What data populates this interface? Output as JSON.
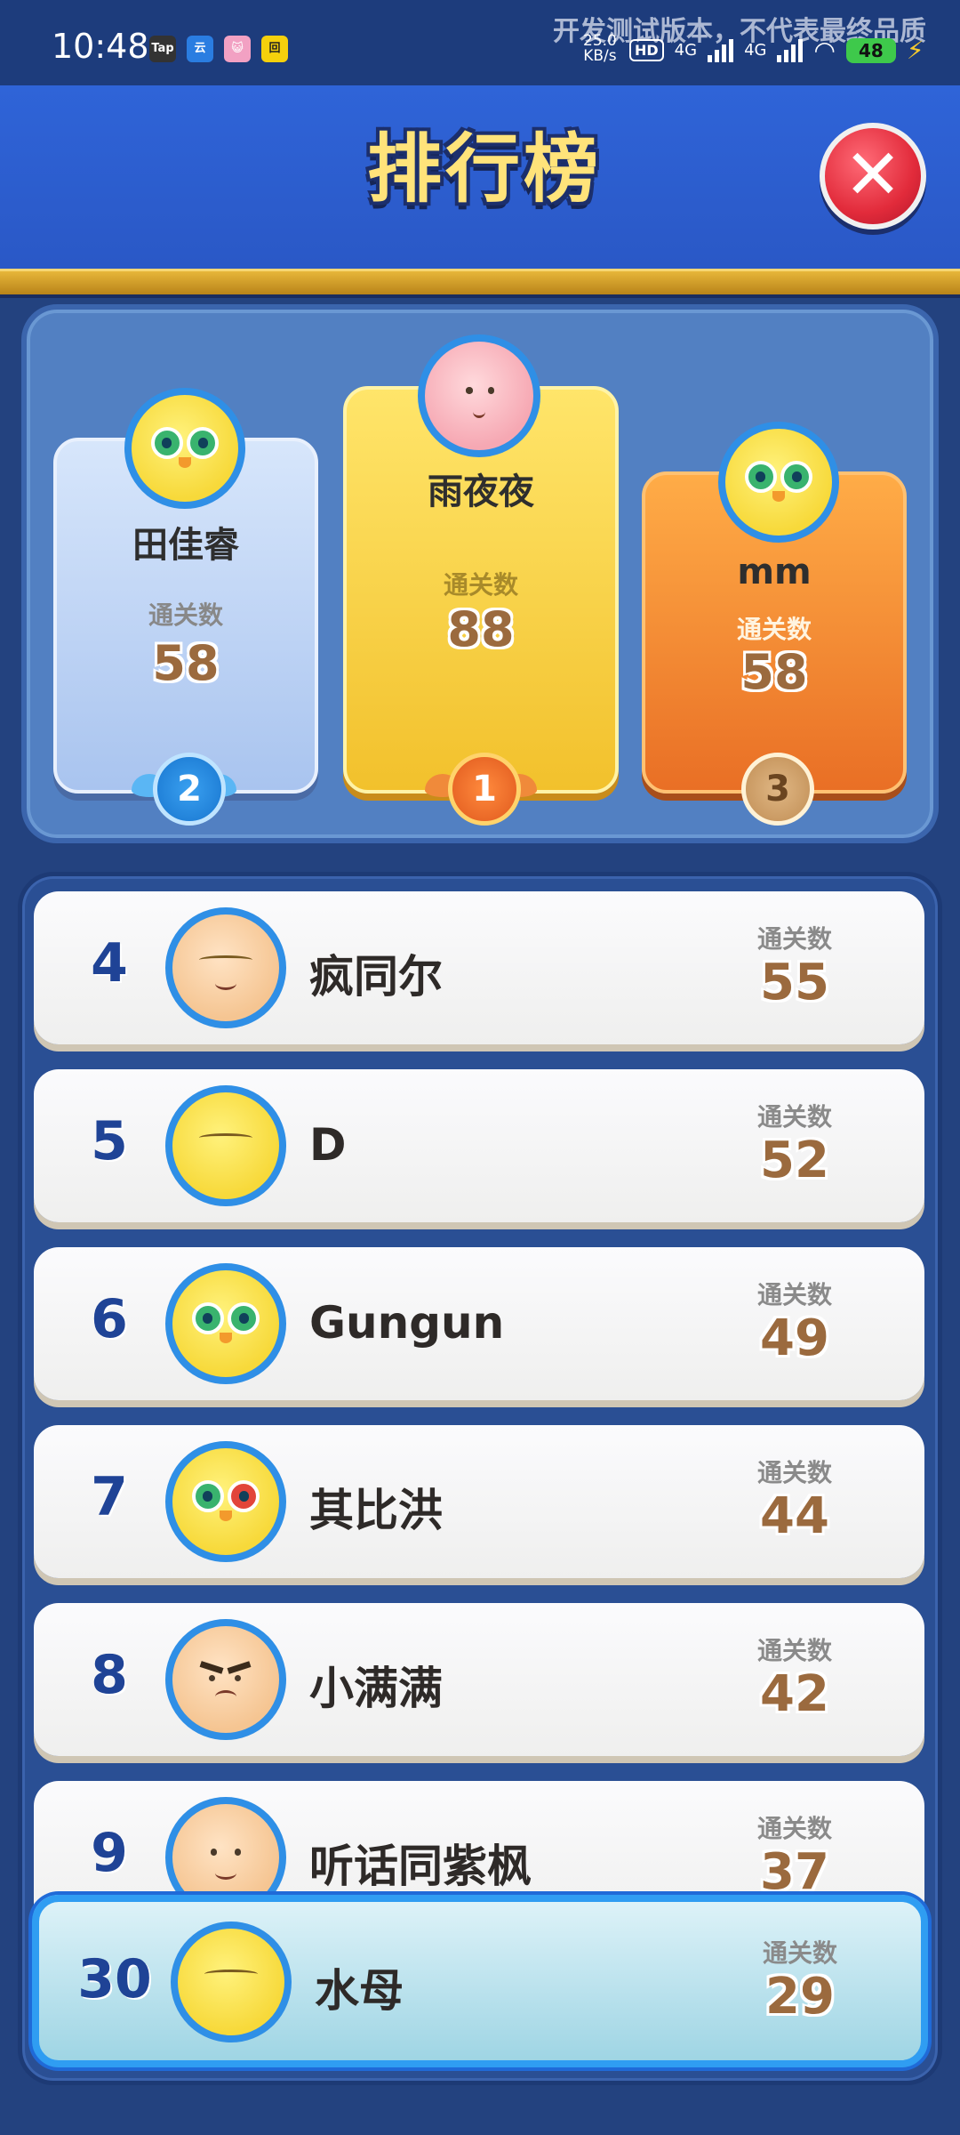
{
  "status_bar": {
    "time": "10:48",
    "apps": [
      "Tap",
      "云",
      "😺",
      "回"
    ],
    "watermark": "开发测试版本，不代表最终品质",
    "speed_value": "25.0",
    "speed_unit": "KB/s",
    "hd": "HD",
    "net1": "4G",
    "net2": "4G",
    "battery": "48"
  },
  "header": {
    "title": "排行榜",
    "close_symbol": "✕"
  },
  "podium": {
    "label": "通关数",
    "first": {
      "name": "雨夜夜",
      "score": "88",
      "medal": "1"
    },
    "second": {
      "name": "田佳睿",
      "score": "58",
      "medal": "2"
    },
    "third": {
      "name": "mm",
      "score": "58",
      "medal": "3"
    }
  },
  "list": {
    "label": "通关数",
    "rows": [
      {
        "rank": "4",
        "name": "疯同尔",
        "score": "55"
      },
      {
        "rank": "5",
        "name": "D",
        "score": "52"
      },
      {
        "rank": "6",
        "name": "Gungun",
        "score": "49"
      },
      {
        "rank": "7",
        "name": "其比洪",
        "score": "44"
      },
      {
        "rank": "8",
        "name": "小满满",
        "score": "42"
      },
      {
        "rank": "9",
        "name": "听话同紫枫",
        "score": "37"
      }
    ]
  },
  "self": {
    "rank": "30",
    "name": "水母",
    "score": "29",
    "label": "通关数"
  }
}
